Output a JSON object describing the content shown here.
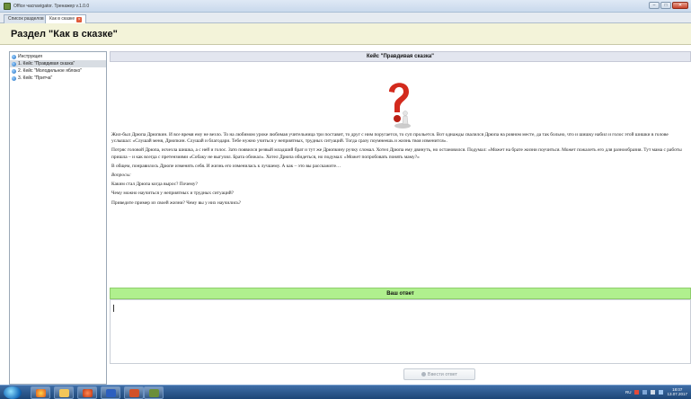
{
  "window": {
    "title": "Office часnavigator. Тренажер v.1.0.0"
  },
  "tabs": [
    {
      "label": "Список разделов"
    },
    {
      "label": "Как в сказке"
    }
  ],
  "section": {
    "title": "Раздел \"Как в сказке\""
  },
  "sidebar": {
    "items": [
      {
        "label": "Инструкция"
      },
      {
        "label": "1. Кейс \"Правдивая сказка\""
      },
      {
        "label": "2. Кейс \"Молодильное яблоко\""
      },
      {
        "label": "3. Кейс \"Притча\""
      }
    ]
  },
  "main": {
    "case_title": "Кейс \"Правдивая сказка\"",
    "paragraphs": [
      "Жил-был Дрюпа Дрюпкин. И все время ему не везло. То на любимом уроке любимая учительница три поставит, то друг с ним поругается, то суп прольется. Вот однажды свалился Дрюпа на ровном месте, да так больно, что и шишку набил и голос этой шишки в голове услышал: «Слушай меня, Дрюпкин. Слушай и благодари. Тебе нужно учиться у неприятных, трудных ситуаций. Тогда сразу поумнеешь и жизнь твоя изменится».",
      "Потряс головой Дрюпа, исчезла шишка, а с ней и голос. Зато появился резвый младший брат и тут же Дрюпкину ручку сломал. Хотел Дрюпа ему двинуть, но остановился. Подумал: «Может на брате жизни поучиться. Может пожалеть его для разнообразия. Тут мама с работы пришла – и как всегда с претензиями «Собаку не выгулял. Брата обижал». Хотел Дрюпа обидеться, но подумал: «Может попробовать понять маму?»",
      "В общем, понравилось Дрюпе изменять себя. И жизнь его изменилась к лучшему. А как – это вы расскажите…"
    ],
    "questions_heading": "Вопросы:",
    "questions": [
      "Каким стал Дрюпа когда вырос? Почему?",
      "Чему можно научиться у неприятных и трудных ситуаций?",
      "Приведите пример из своей жизни? Чему вы у них научились?"
    ],
    "answer_heading": "Ваш ответ",
    "answer_value": "",
    "submit_label": "Ввести ответ"
  },
  "taskbar": {
    "tray_lang": "RU",
    "time": "18:07",
    "date": "13.07.2017"
  },
  "colors": {
    "answer_header": "#b0f08e",
    "section_header_bg": "#f3f3d9",
    "case_title_bg": "#e3e6ef",
    "question_mark": "#d32a1d"
  }
}
